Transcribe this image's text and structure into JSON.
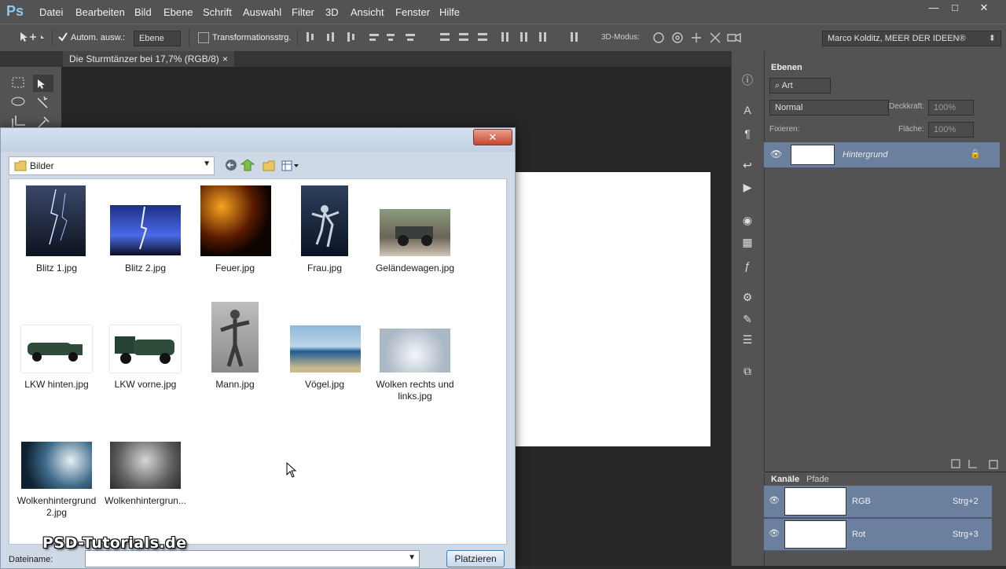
{
  "app": {
    "logo": "Ps"
  },
  "menubar": {
    "items": [
      "Datei",
      "Bearbeiten",
      "Bild",
      "Ebene",
      "Schrift",
      "Auswahl",
      "Filter",
      "3D",
      "Ansicht",
      "Fenster",
      "Hilfe"
    ]
  },
  "window_controls": {
    "minimize": "—",
    "maximize": "□",
    "close": "✕"
  },
  "options_bar": {
    "auto_select_label": "Autom. ausw.:",
    "auto_select_value": "Ebene",
    "transform_label": "Transformationsstrg.",
    "mode_3d_label": "3D-Modus:",
    "workspace": "Marco Kolditz, MEER DER IDEEN®"
  },
  "document": {
    "tab_title": "Die Sturmtänzer bei 17,7% (RGB/8)",
    "tab_close": "×"
  },
  "dialog": {
    "close_glyph": "✕",
    "look_in": "Bilder",
    "files": [
      {
        "name": "Blitz 1.jpg",
        "icon": "lightning-thumbnail"
      },
      {
        "name": "Blitz 2.jpg",
        "icon": "lightning-thumbnail"
      },
      {
        "name": "Feuer.jpg",
        "icon": "fire-thumbnail"
      },
      {
        "name": "Frau.jpg",
        "icon": "woman-thumbnail"
      },
      {
        "name": "Geländewagen.jpg",
        "icon": "offroad-car-thumbnail"
      },
      {
        "name": "LKW hinten.jpg",
        "icon": "truck-thumbnail"
      },
      {
        "name": "LKW vorne.jpg",
        "icon": "truck-thumbnail"
      },
      {
        "name": "Mann.jpg",
        "icon": "man-thumbnail"
      },
      {
        "name": "Vögel.jpg",
        "icon": "birds-sea-thumbnail"
      },
      {
        "name": "Wolken rechts und links.jpg",
        "icon": "clouds-thumbnail"
      },
      {
        "name": "Wolkenhintergrund 2.jpg",
        "icon": "clouds-thumbnail"
      },
      {
        "name": "Wolkenhintergrun...",
        "icon": "clouds-thumbnail"
      }
    ],
    "filename_label": "Dateiname:",
    "filename_value": "",
    "place_button": "Platzieren"
  },
  "layers_panel": {
    "tab": "Ebenen",
    "filter_kind": "Art",
    "blend_mode": "Normal",
    "opacity_label": "Deckkraft:",
    "opacity_value": "100%",
    "lock_label": "Fixieren:",
    "fill_label": "Fläche:",
    "fill_value": "100%",
    "layers": [
      {
        "name": "Hintergrund",
        "locked": true
      }
    ]
  },
  "channels_panel": {
    "tabs": [
      "Kanäle",
      "Pfade"
    ],
    "channels": [
      {
        "name": "RGB",
        "shortcut": "Strg+2"
      },
      {
        "name": "Rot",
        "shortcut": "Strg+3"
      }
    ]
  },
  "watermark": "PSD-Tutorials.de",
  "colors": {
    "ps_chrome": "#535353",
    "canvas_bg": "#262626",
    "layer_selected": "#6b7f9e",
    "dialog_frame": "#cfd9e6"
  }
}
